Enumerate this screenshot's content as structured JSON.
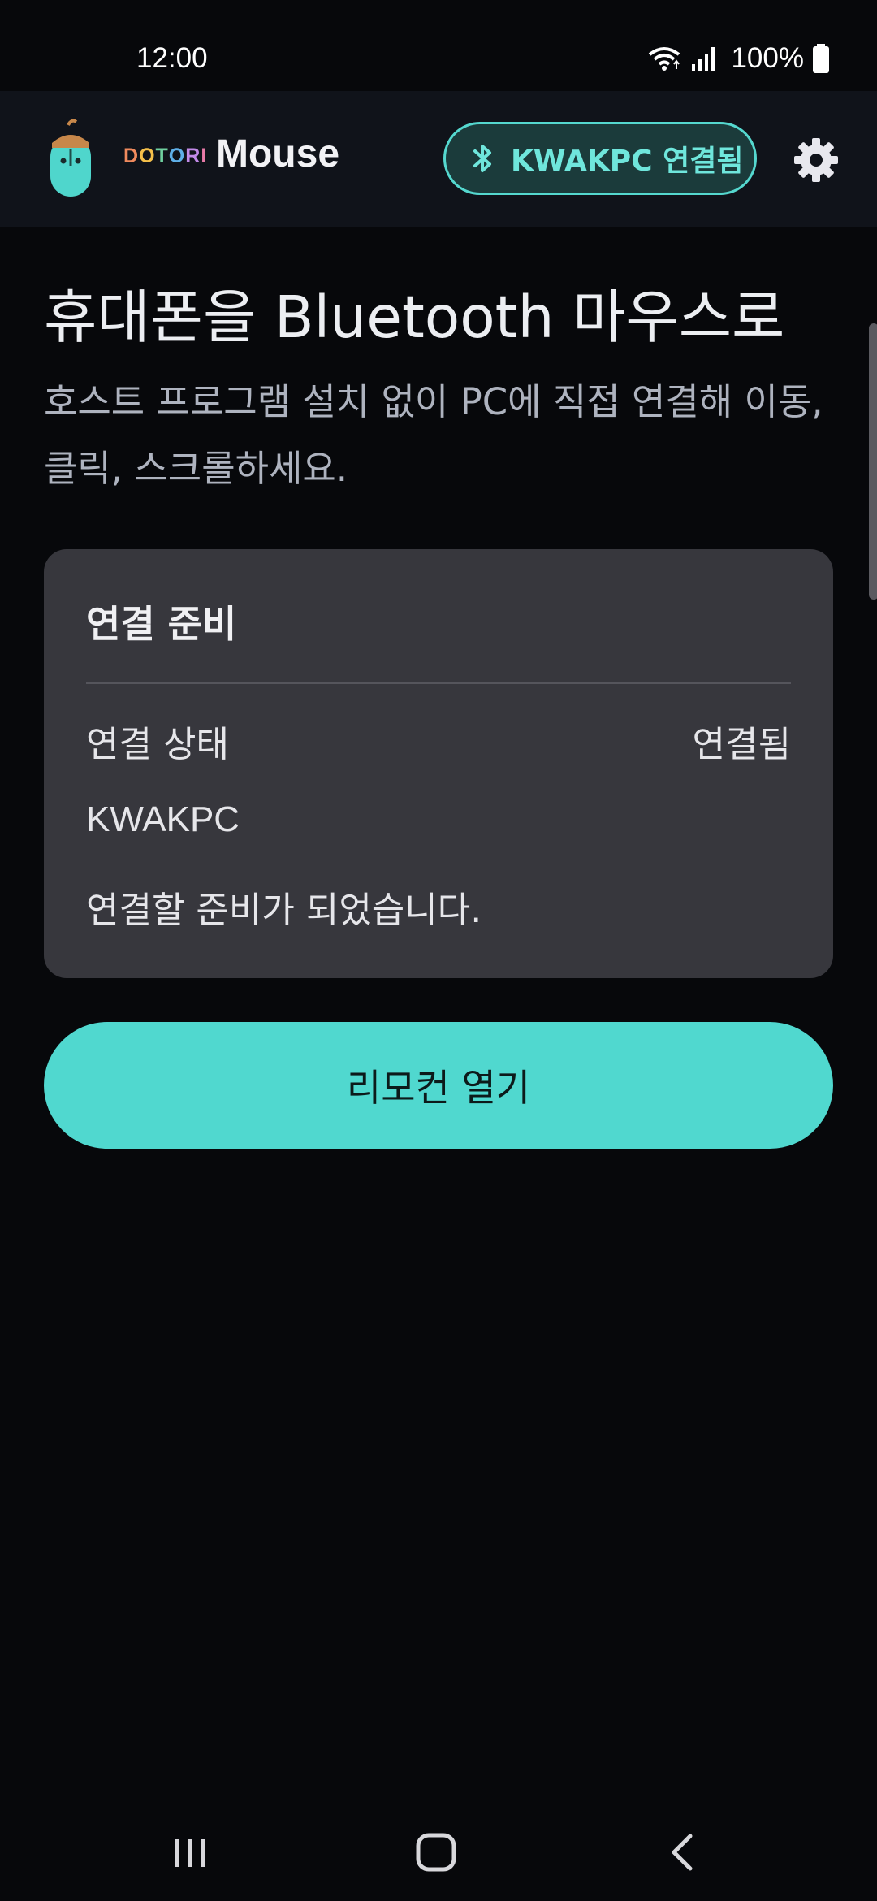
{
  "status_bar": {
    "time": "12:00",
    "battery": "100%",
    "icons": [
      "wifi-icon",
      "signal-icon",
      "battery-icon"
    ]
  },
  "app_bar": {
    "brand_prefix": "DOTORI",
    "brand_name": "Mouse",
    "connection_chip": "KWAKPC 연결됨",
    "icons": [
      "mascot-logo-icon",
      "bluetooth-icon",
      "gear-icon"
    ]
  },
  "hero": {
    "title": "휴대폰을 Bluetooth 마우스로",
    "subtitle": "호스트 프로그램 설치 없이 PC에 직접 연결해 이동, 클릭, 스크롤하세요."
  },
  "status_card": {
    "title": "연결 준비",
    "status_label": "연결 상태",
    "status_value": "연결됨",
    "device_name": "KWAKPC",
    "message": "연결할 준비가 되었습니다."
  },
  "primary_button": {
    "label": "리모컨 열기"
  },
  "nav_bar": {
    "icons": [
      "recent-apps-icon",
      "home-icon",
      "back-icon"
    ]
  },
  "colors": {
    "background": "#07080b",
    "app_bar": "#10131a",
    "accent": "#50d8cf",
    "card": "#37373d",
    "brand_letters": [
      "#f08a5d",
      "#f5c04a",
      "#6fd1a0",
      "#5fb0e8",
      "#c28ae8",
      "#e97aa8"
    ]
  }
}
